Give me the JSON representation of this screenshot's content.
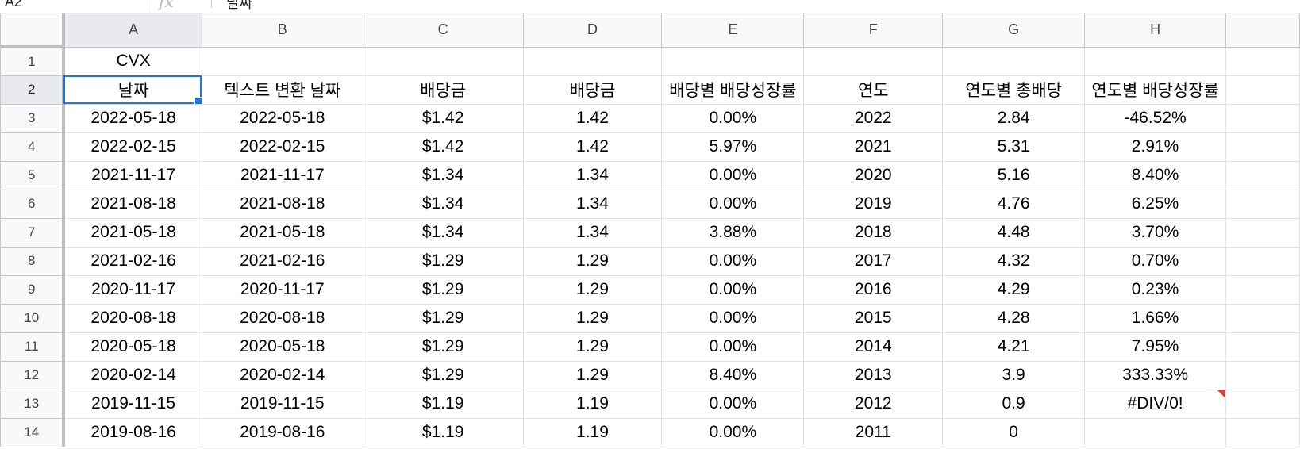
{
  "formula_bar": {
    "name_box": "A2",
    "fx_icon": "fx",
    "content": "날짜"
  },
  "columns": [
    "A",
    "B",
    "C",
    "D",
    "E",
    "F",
    "G",
    "H"
  ],
  "row_numbers": [
    "1",
    "2",
    "3",
    "4",
    "5",
    "6",
    "7",
    "8",
    "9",
    "10",
    "11",
    "12",
    "13",
    "14"
  ],
  "rows": [
    [
      "CVX",
      "",
      "",
      "",
      "",
      "",
      "",
      ""
    ],
    [
      "날짜",
      "텍스트 변환 날짜",
      "배당금",
      "배당금",
      "배당별 배당성장률",
      "연도",
      "연도별 총배당",
      "연도별 배당성장률"
    ],
    [
      "2022-05-18",
      "2022-05-18",
      "$1.42",
      "1.42",
      "0.00%",
      "2022",
      "2.84",
      "-46.52%"
    ],
    [
      "2022-02-15",
      "2022-02-15",
      "$1.42",
      "1.42",
      "5.97%",
      "2021",
      "5.31",
      "2.91%"
    ],
    [
      "2021-11-17",
      "2021-11-17",
      "$1.34",
      "1.34",
      "0.00%",
      "2020",
      "5.16",
      "8.40%"
    ],
    [
      "2021-08-18",
      "2021-08-18",
      "$1.34",
      "1.34",
      "0.00%",
      "2019",
      "4.76",
      "6.25%"
    ],
    [
      "2021-05-18",
      "2021-05-18",
      "$1.34",
      "1.34",
      "3.88%",
      "2018",
      "4.48",
      "3.70%"
    ],
    [
      "2021-02-16",
      "2021-02-16",
      "$1.29",
      "1.29",
      "0.00%",
      "2017",
      "4.32",
      "0.70%"
    ],
    [
      "2020-11-17",
      "2020-11-17",
      "$1.29",
      "1.29",
      "0.00%",
      "2016",
      "4.29",
      "0.23%"
    ],
    [
      "2020-08-18",
      "2020-08-18",
      "$1.29",
      "1.29",
      "0.00%",
      "2015",
      "4.28",
      "1.66%"
    ],
    [
      "2020-05-18",
      "2020-05-18",
      "$1.29",
      "1.29",
      "0.00%",
      "2014",
      "4.21",
      "7.95%"
    ],
    [
      "2020-02-14",
      "2020-02-14",
      "$1.29",
      "1.29",
      "8.40%",
      "2013",
      "3.9",
      "333.33%"
    ],
    [
      "2019-11-15",
      "2019-11-15",
      "$1.19",
      "1.19",
      "0.00%",
      "2012",
      "0.9",
      "#DIV/0!"
    ],
    [
      "2019-08-16",
      "2019-08-16",
      "$1.19",
      "1.19",
      "0.00%",
      "2011",
      "0",
      ""
    ]
  ],
  "active_cell": {
    "row": 2,
    "col": "A"
  },
  "note_cell": {
    "row": 13,
    "col": "H"
  },
  "colors": {
    "selection": "#1a73e8",
    "note_flag": "#e53935",
    "header_bg": "#f8f9fa",
    "header_selected_bg": "#e8eaed",
    "gridline": "#e2e2e2"
  }
}
